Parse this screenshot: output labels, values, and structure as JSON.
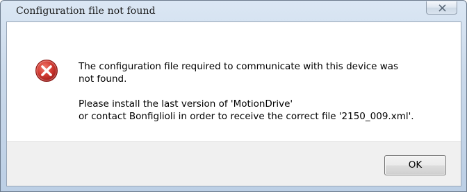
{
  "window": {
    "title": "Configuration file not found",
    "close_glyph": "×",
    "close_icon": "close-icon"
  },
  "dialog": {
    "icon": "error-icon",
    "icon_color": "#c62d2d",
    "message_line1": "The configuration file required to communicate with this device was",
    "message_line2": "not found.",
    "message_line3": "Please install the last version of 'MotionDrive'",
    "message_line4": "or contact Bonfiglioli in order to receive the correct file '2150_009.xml'."
  },
  "footer": {
    "ok_label": "OK"
  }
}
